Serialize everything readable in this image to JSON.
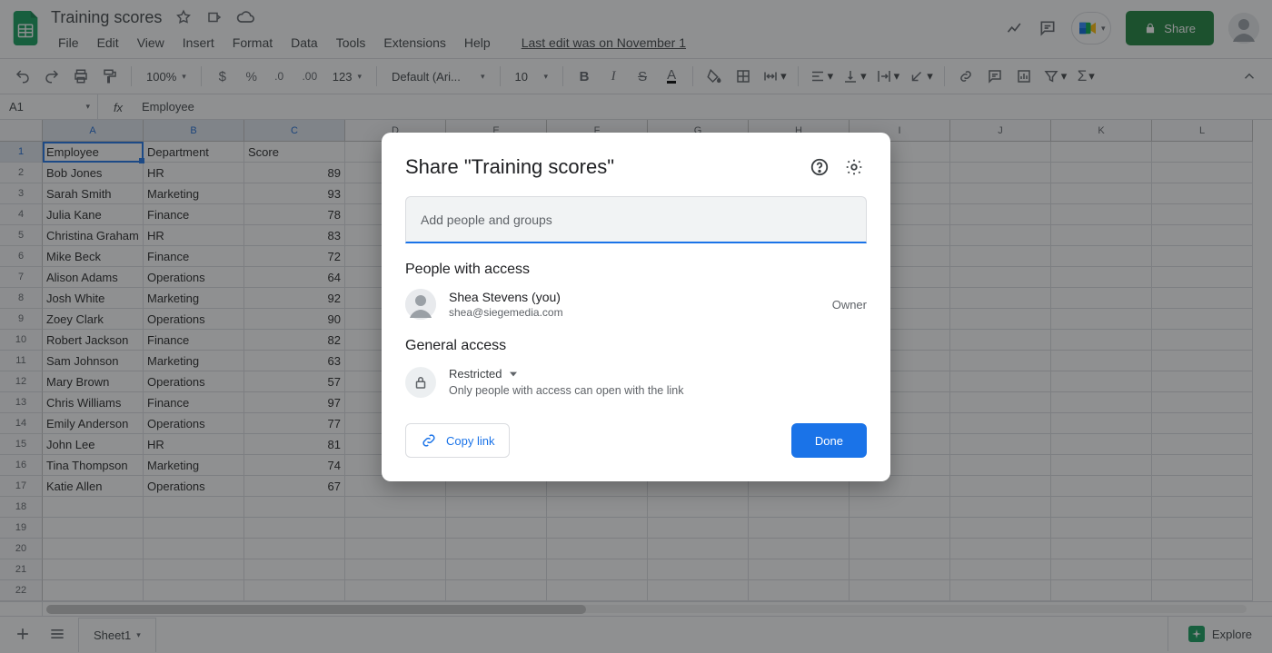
{
  "doc_title": "Training scores",
  "menus": [
    "File",
    "Edit",
    "View",
    "Insert",
    "Format",
    "Data",
    "Tools",
    "Extensions",
    "Help"
  ],
  "last_edit": "Last edit was on November 1",
  "share_label": "Share",
  "toolbar": {
    "zoom": "100%",
    "font": "Default (Ari...",
    "font_size": "10"
  },
  "namebox": "A1",
  "fx_value": "Employee",
  "columns": [
    "A",
    "B",
    "C",
    "D",
    "E",
    "F",
    "G",
    "H",
    "I",
    "J",
    "K",
    "L"
  ],
  "col_sel": [
    true,
    true,
    true,
    false,
    false,
    false,
    false,
    false,
    false,
    false,
    false,
    false
  ],
  "rows": [
    {
      "n": 1,
      "sel": true,
      "c": [
        "Employee",
        "Department",
        "Score",
        "",
        "",
        "",
        "",
        "",
        "",
        "",
        "",
        ""
      ]
    },
    {
      "n": 2,
      "c": [
        "Bob Jones",
        "HR",
        "89",
        "",
        "",
        "",
        "",
        "",
        "",
        "",
        "",
        ""
      ]
    },
    {
      "n": 3,
      "c": [
        "Sarah Smith",
        "Marketing",
        "93",
        "",
        "",
        "",
        "",
        "",
        "",
        "",
        "",
        ""
      ]
    },
    {
      "n": 4,
      "c": [
        "Julia Kane",
        "Finance",
        "78",
        "",
        "",
        "",
        "",
        "",
        "",
        "",
        "",
        ""
      ]
    },
    {
      "n": 5,
      "c": [
        "Christina Graham",
        "HR",
        "83",
        "",
        "",
        "",
        "",
        "",
        "",
        "",
        "",
        ""
      ]
    },
    {
      "n": 6,
      "c": [
        "Mike Beck",
        "Finance",
        "72",
        "",
        "",
        "",
        "",
        "",
        "",
        "",
        "",
        ""
      ]
    },
    {
      "n": 7,
      "c": [
        "Alison Adams",
        "Operations",
        "64",
        "",
        "",
        "",
        "",
        "",
        "",
        "",
        "",
        ""
      ]
    },
    {
      "n": 8,
      "c": [
        "Josh White",
        "Marketing",
        "92",
        "",
        "",
        "",
        "",
        "",
        "",
        "",
        "",
        ""
      ]
    },
    {
      "n": 9,
      "c": [
        "Zoey Clark",
        "Operations",
        "90",
        "",
        "",
        "",
        "",
        "",
        "",
        "",
        "",
        ""
      ]
    },
    {
      "n": 10,
      "c": [
        "Robert Jackson",
        "Finance",
        "82",
        "",
        "",
        "",
        "",
        "",
        "",
        "",
        "",
        ""
      ]
    },
    {
      "n": 11,
      "c": [
        "Sam Johnson",
        "Marketing",
        "63",
        "",
        "",
        "",
        "",
        "",
        "",
        "",
        "",
        ""
      ]
    },
    {
      "n": 12,
      "c": [
        "Mary Brown",
        "Operations",
        "57",
        "",
        "",
        "",
        "",
        "",
        "",
        "",
        "",
        ""
      ]
    },
    {
      "n": 13,
      "c": [
        "Chris Williams",
        "Finance",
        "97",
        "",
        "",
        "",
        "",
        "",
        "",
        "",
        "",
        ""
      ]
    },
    {
      "n": 14,
      "c": [
        "Emily Anderson",
        "Operations",
        "77",
        "",
        "",
        "",
        "",
        "",
        "",
        "",
        "",
        ""
      ]
    },
    {
      "n": 15,
      "c": [
        "John Lee",
        "HR",
        "81",
        "",
        "",
        "",
        "",
        "",
        "",
        "",
        "",
        ""
      ]
    },
    {
      "n": 16,
      "c": [
        "Tina Thompson",
        "Marketing",
        "74",
        "",
        "",
        "",
        "",
        "",
        "",
        "",
        "",
        ""
      ]
    },
    {
      "n": 17,
      "c": [
        "Katie Allen",
        "Operations",
        "67",
        "",
        "",
        "",
        "",
        "",
        "",
        "",
        "",
        ""
      ]
    },
    {
      "n": 18,
      "c": [
        "",
        "",
        "",
        "",
        "",
        "",
        "",
        "",
        "",
        "",
        "",
        ""
      ]
    },
    {
      "n": 19,
      "c": [
        "",
        "",
        "",
        "",
        "",
        "",
        "",
        "",
        "",
        "",
        "",
        ""
      ]
    },
    {
      "n": 20,
      "c": [
        "",
        "",
        "",
        "",
        "",
        "",
        "",
        "",
        "",
        "",
        "",
        ""
      ]
    },
    {
      "n": 21,
      "c": [
        "",
        "",
        "",
        "",
        "",
        "",
        "",
        "",
        "",
        "",
        "",
        ""
      ]
    },
    {
      "n": 22,
      "c": [
        "",
        "",
        "",
        "",
        "",
        "",
        "",
        "",
        "",
        "",
        "",
        ""
      ]
    }
  ],
  "right_align_col": 2,
  "sheet_tab": "Sheet1",
  "explore_label": "Explore",
  "share_dialog": {
    "title": "Share \"Training scores\"",
    "add_placeholder": "Add people and groups",
    "people_heading": "People with access",
    "person_name": "Shea Stevens (you)",
    "person_email": "shea@siegemedia.com",
    "person_role": "Owner",
    "general_heading": "General access",
    "access_level": "Restricted",
    "access_desc": "Only people with access can open with the link",
    "copy_link": "Copy link",
    "done": "Done"
  }
}
